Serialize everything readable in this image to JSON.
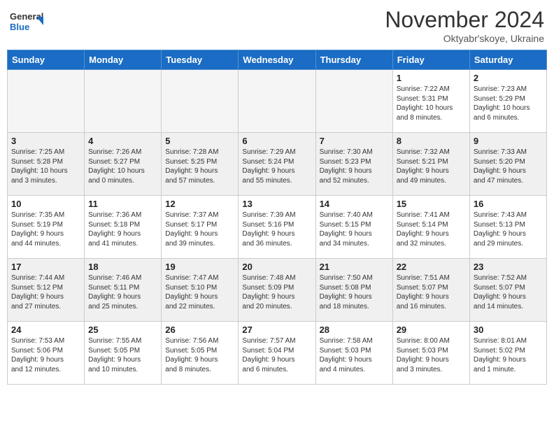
{
  "logo": {
    "line1": "General",
    "line2": "Blue"
  },
  "title": "November 2024",
  "subtitle": "Oktyabr'skoye, Ukraine",
  "weekdays": [
    "Sunday",
    "Monday",
    "Tuesday",
    "Wednesday",
    "Thursday",
    "Friday",
    "Saturday"
  ],
  "weeks": [
    [
      {
        "day": "",
        "info": ""
      },
      {
        "day": "",
        "info": ""
      },
      {
        "day": "",
        "info": ""
      },
      {
        "day": "",
        "info": ""
      },
      {
        "day": "",
        "info": ""
      },
      {
        "day": "1",
        "info": "Sunrise: 7:22 AM\nSunset: 5:31 PM\nDaylight: 10 hours\nand 8 minutes."
      },
      {
        "day": "2",
        "info": "Sunrise: 7:23 AM\nSunset: 5:29 PM\nDaylight: 10 hours\nand 6 minutes."
      }
    ],
    [
      {
        "day": "3",
        "info": "Sunrise: 7:25 AM\nSunset: 5:28 PM\nDaylight: 10 hours\nand 3 minutes."
      },
      {
        "day": "4",
        "info": "Sunrise: 7:26 AM\nSunset: 5:27 PM\nDaylight: 10 hours\nand 0 minutes."
      },
      {
        "day": "5",
        "info": "Sunrise: 7:28 AM\nSunset: 5:25 PM\nDaylight: 9 hours\nand 57 minutes."
      },
      {
        "day": "6",
        "info": "Sunrise: 7:29 AM\nSunset: 5:24 PM\nDaylight: 9 hours\nand 55 minutes."
      },
      {
        "day": "7",
        "info": "Sunrise: 7:30 AM\nSunset: 5:23 PM\nDaylight: 9 hours\nand 52 minutes."
      },
      {
        "day": "8",
        "info": "Sunrise: 7:32 AM\nSunset: 5:21 PM\nDaylight: 9 hours\nand 49 minutes."
      },
      {
        "day": "9",
        "info": "Sunrise: 7:33 AM\nSunset: 5:20 PM\nDaylight: 9 hours\nand 47 minutes."
      }
    ],
    [
      {
        "day": "10",
        "info": "Sunrise: 7:35 AM\nSunset: 5:19 PM\nDaylight: 9 hours\nand 44 minutes."
      },
      {
        "day": "11",
        "info": "Sunrise: 7:36 AM\nSunset: 5:18 PM\nDaylight: 9 hours\nand 41 minutes."
      },
      {
        "day": "12",
        "info": "Sunrise: 7:37 AM\nSunset: 5:17 PM\nDaylight: 9 hours\nand 39 minutes."
      },
      {
        "day": "13",
        "info": "Sunrise: 7:39 AM\nSunset: 5:16 PM\nDaylight: 9 hours\nand 36 minutes."
      },
      {
        "day": "14",
        "info": "Sunrise: 7:40 AM\nSunset: 5:15 PM\nDaylight: 9 hours\nand 34 minutes."
      },
      {
        "day": "15",
        "info": "Sunrise: 7:41 AM\nSunset: 5:14 PM\nDaylight: 9 hours\nand 32 minutes."
      },
      {
        "day": "16",
        "info": "Sunrise: 7:43 AM\nSunset: 5:13 PM\nDaylight: 9 hours\nand 29 minutes."
      }
    ],
    [
      {
        "day": "17",
        "info": "Sunrise: 7:44 AM\nSunset: 5:12 PM\nDaylight: 9 hours\nand 27 minutes."
      },
      {
        "day": "18",
        "info": "Sunrise: 7:46 AM\nSunset: 5:11 PM\nDaylight: 9 hours\nand 25 minutes."
      },
      {
        "day": "19",
        "info": "Sunrise: 7:47 AM\nSunset: 5:10 PM\nDaylight: 9 hours\nand 22 minutes."
      },
      {
        "day": "20",
        "info": "Sunrise: 7:48 AM\nSunset: 5:09 PM\nDaylight: 9 hours\nand 20 minutes."
      },
      {
        "day": "21",
        "info": "Sunrise: 7:50 AM\nSunset: 5:08 PM\nDaylight: 9 hours\nand 18 minutes."
      },
      {
        "day": "22",
        "info": "Sunrise: 7:51 AM\nSunset: 5:07 PM\nDaylight: 9 hours\nand 16 minutes."
      },
      {
        "day": "23",
        "info": "Sunrise: 7:52 AM\nSunset: 5:07 PM\nDaylight: 9 hours\nand 14 minutes."
      }
    ],
    [
      {
        "day": "24",
        "info": "Sunrise: 7:53 AM\nSunset: 5:06 PM\nDaylight: 9 hours\nand 12 minutes."
      },
      {
        "day": "25",
        "info": "Sunrise: 7:55 AM\nSunset: 5:05 PM\nDaylight: 9 hours\nand 10 minutes."
      },
      {
        "day": "26",
        "info": "Sunrise: 7:56 AM\nSunset: 5:05 PM\nDaylight: 9 hours\nand 8 minutes."
      },
      {
        "day": "27",
        "info": "Sunrise: 7:57 AM\nSunset: 5:04 PM\nDaylight: 9 hours\nand 6 minutes."
      },
      {
        "day": "28",
        "info": "Sunrise: 7:58 AM\nSunset: 5:03 PM\nDaylight: 9 hours\nand 4 minutes."
      },
      {
        "day": "29",
        "info": "Sunrise: 8:00 AM\nSunset: 5:03 PM\nDaylight: 9 hours\nand 3 minutes."
      },
      {
        "day": "30",
        "info": "Sunrise: 8:01 AM\nSunset: 5:02 PM\nDaylight: 9 hours\nand 1 minute."
      }
    ]
  ]
}
